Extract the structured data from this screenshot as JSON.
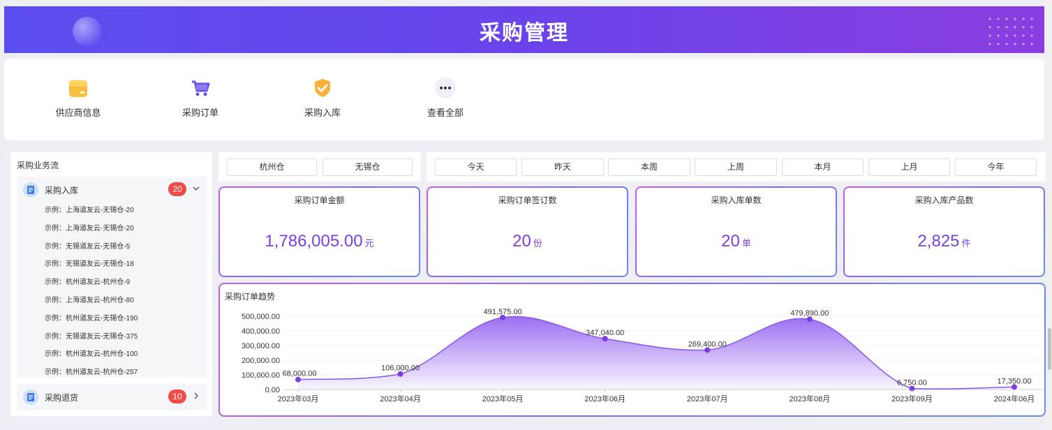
{
  "header": {
    "title": "采购管理"
  },
  "quick_links": [
    {
      "label": "供应商信息",
      "icon": "folder-icon"
    },
    {
      "label": "采购订单",
      "icon": "cart-icon"
    },
    {
      "label": "采购入库",
      "icon": "shield-check-icon"
    },
    {
      "label": "查看全部",
      "icon": "more-icon"
    }
  ],
  "workflow": {
    "title": "采购业务流",
    "inbound": {
      "label": "采购入库",
      "count": "20",
      "items": [
        "示例：上海道友云-无锡仓-20",
        "示例：上海道友云-无锡仓-20",
        "示例：无锡道友云-无锡仓-5",
        "示例：无锡道友云-无锡仓-18",
        "示例：杭州道友云-杭州仓-9",
        "示例：上海道友云-杭州仓-80",
        "示例：杭州道友云-无锡仓-190",
        "示例：无锡道友云-无锡仓-375",
        "示例：杭州道友云-杭州仓-100",
        "示例：杭州道友云-杭州仓-257"
      ]
    },
    "returns": {
      "label": "采购退货",
      "count": "10"
    }
  },
  "warehouses": [
    "杭州仓",
    "无锡仓"
  ],
  "periods": [
    "今天",
    "昨天",
    "本周",
    "上周",
    "本月",
    "上月",
    "今年"
  ],
  "stats": [
    {
      "title": "采购订单金额",
      "value": "1,786,005.00",
      "unit": "元"
    },
    {
      "title": "采购订单签订数",
      "value": "20",
      "unit": "份"
    },
    {
      "title": "采购入库单数",
      "value": "20",
      "unit": "单"
    },
    {
      "title": "采购入库产品数",
      "value": "2,825",
      "unit": "件"
    }
  ],
  "colors": {
    "accent": "#7b3fe0",
    "badge": "#ef4b4b",
    "banner_start": "#5b4ef0",
    "banner_end": "#8a3ee0"
  },
  "chart_data": {
    "type": "area",
    "title": "采购订单趋势",
    "categories": [
      "2023年03月",
      "2023年04月",
      "2023年05月",
      "2023年06月",
      "2023年07月",
      "2023年08月",
      "2023年09月",
      "2024年06月"
    ],
    "values": [
      68000,
      106000,
      491575,
      347040,
      269400,
      479890,
      6750,
      17350
    ],
    "value_labels": [
      "68,000.00",
      "106,000.00",
      "491,575.00",
      "347,040.00",
      "269,400.00",
      "479,890.00",
      "6,750.00",
      "17,350.00"
    ],
    "yticks": [
      "0.00",
      "100,000.00",
      "200,000.00",
      "300,000.00",
      "400,000.00",
      "500,000.00"
    ],
    "ylim": [
      0,
      500000
    ],
    "smooth": true,
    "grid": true,
    "legend": "none"
  }
}
